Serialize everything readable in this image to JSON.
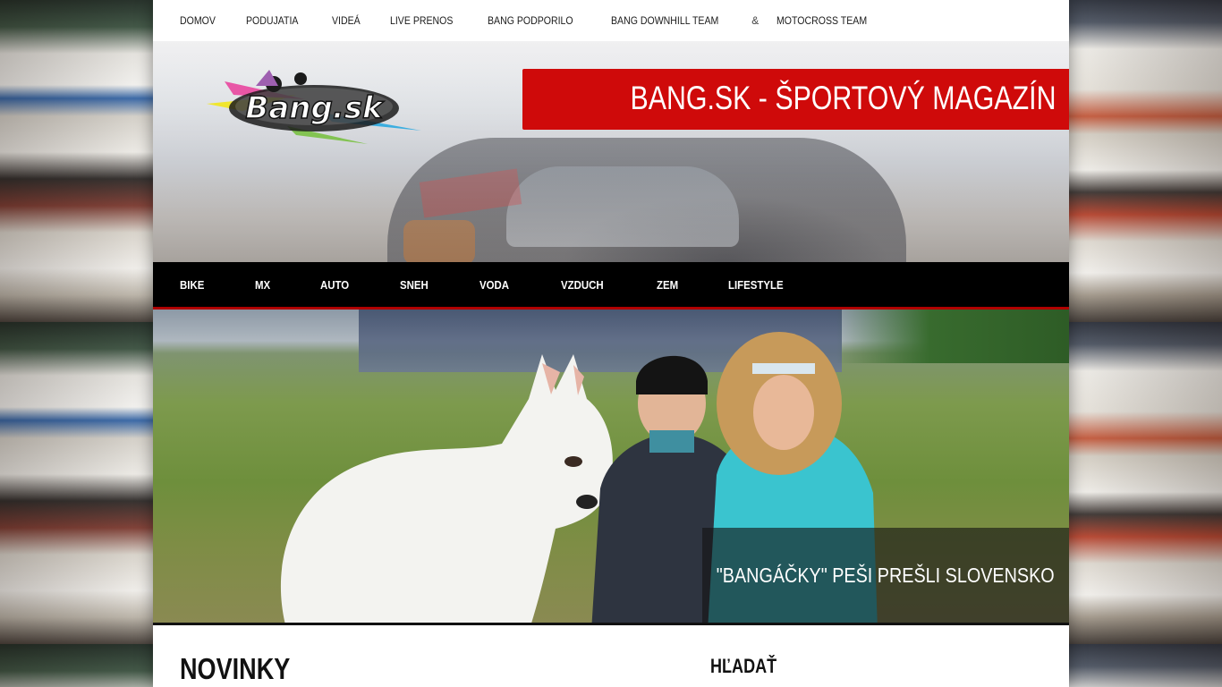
{
  "top_nav": {
    "items": [
      {
        "label": "DOMOV"
      },
      {
        "label": "PODUJATIA"
      },
      {
        "label": "VIDEÁ"
      },
      {
        "label": "LIVE PRENOS"
      },
      {
        "label": "BANG PODPORILO"
      },
      {
        "label": "BANG DOWNHILL TEAM"
      }
    ],
    "separator": "&",
    "last_item": "MOTOCROSS TEAM"
  },
  "header": {
    "logo_text": "Bang.sk",
    "site_title": "BANG.SK - ŠPORTOVÝ MAGAZÍN",
    "accent_color": "#cf0a0a"
  },
  "category_nav": {
    "items": [
      {
        "label": "BIKE"
      },
      {
        "label": "MX"
      },
      {
        "label": "AUTO"
      },
      {
        "label": "SNEH"
      },
      {
        "label": "VODA"
      },
      {
        "label": "VZDUCH"
      },
      {
        "label": "ZEM"
      },
      {
        "label": "LIFESTYLE"
      }
    ]
  },
  "hero": {
    "caption": "\"BANGÁČKY\" PEŠI PREŠLI SLOVENSKO"
  },
  "main": {
    "news_heading": "NOVINKY"
  },
  "sidebar": {
    "search_heading": "HĽADAŤ"
  }
}
